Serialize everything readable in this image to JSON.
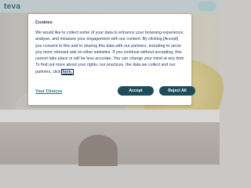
{
  "header": {
    "logo_text": "teva"
  },
  "cookie_dialog": {
    "title": "Cookies",
    "body_text": "We would like to collect some of your data to enhance your browsing experience, analyse, and measure your engagement with our content. By clicking [Accept] you consent to this and to sharing this data with our partners, including to serve you more relevant ads on other websites. If you continue without accepting, this cannot take place or will be less accurate. You can change your mind at any time. To find out more about your rights, our practices, the data we collect and our partners, click ",
    "here_link": "here.",
    "your_choices": "Your Choices",
    "accept_label": "Accept",
    "reject_label": "Reject All"
  },
  "colors": {
    "brand_teal": "#2f6f7a",
    "button_bg": "#1d4d5c",
    "text_navy": "#1c2f5a"
  }
}
